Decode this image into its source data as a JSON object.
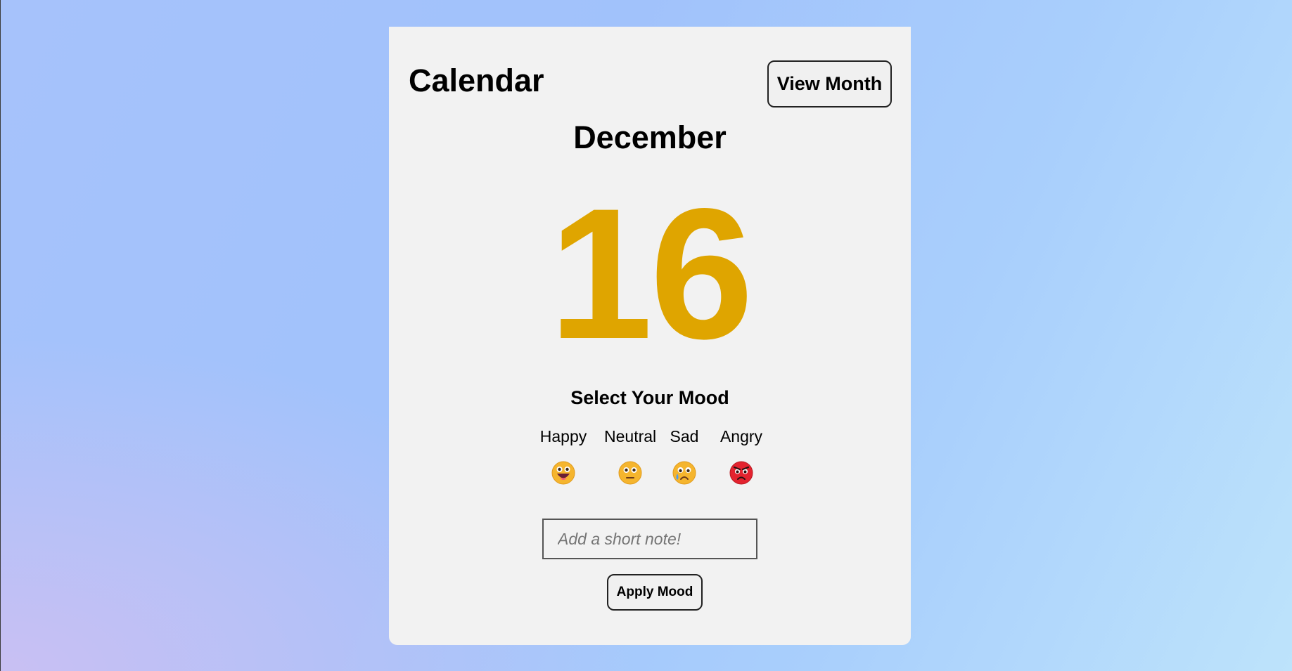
{
  "header": {
    "title": "Calendar",
    "view_month_label": "View Month"
  },
  "date": {
    "month": "December",
    "day": "16",
    "day_color": "#dfa500"
  },
  "mood": {
    "heading": "Select Your Mood",
    "options": [
      {
        "label": "Happy",
        "icon": "happy-face-icon"
      },
      {
        "label": "Neutral",
        "icon": "neutral-face-icon"
      },
      {
        "label": "Sad",
        "icon": "sad-tear-face-icon"
      },
      {
        "label": "Angry",
        "icon": "angry-face-icon"
      }
    ]
  },
  "note": {
    "value": "",
    "placeholder": "Add a short note!"
  },
  "apply_label": "Apply Mood"
}
